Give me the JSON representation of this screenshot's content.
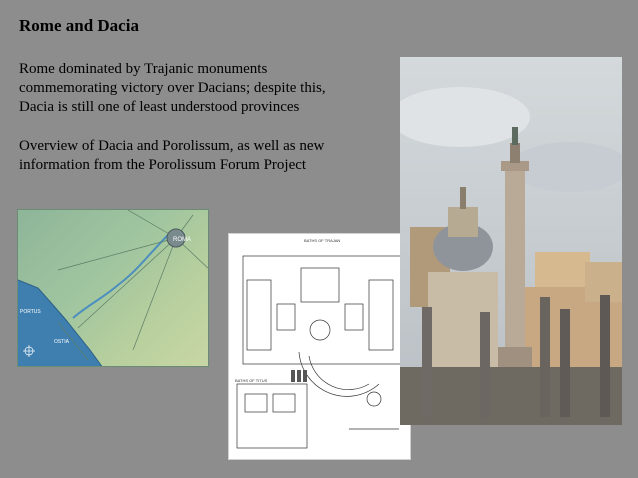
{
  "slide": {
    "title": "Rome and Dacia",
    "para1_line1": "Rome dominated by Trajanic monuments",
    "para1_line2": "commemorating victory over Dacians; despite this,",
    "para1_line3": "Dacia is still one of least understood provinces",
    "para2_line1": "Overview of Dacia and Porolissum, as well as new",
    "para2_line2": "information from the Porolissum Forum Project"
  },
  "map": {
    "label_roma": "ROMA",
    "label_portus": "PORTUS",
    "label_ostia": "OSTIA"
  },
  "plan": {
    "caption_top": "BATHS OF TRAJAN",
    "caption_left": "BATHS OF TITUS"
  },
  "colors": {
    "background": "#8d8d8d",
    "sea": "#3e7fb0",
    "land": "#9ec49f"
  }
}
